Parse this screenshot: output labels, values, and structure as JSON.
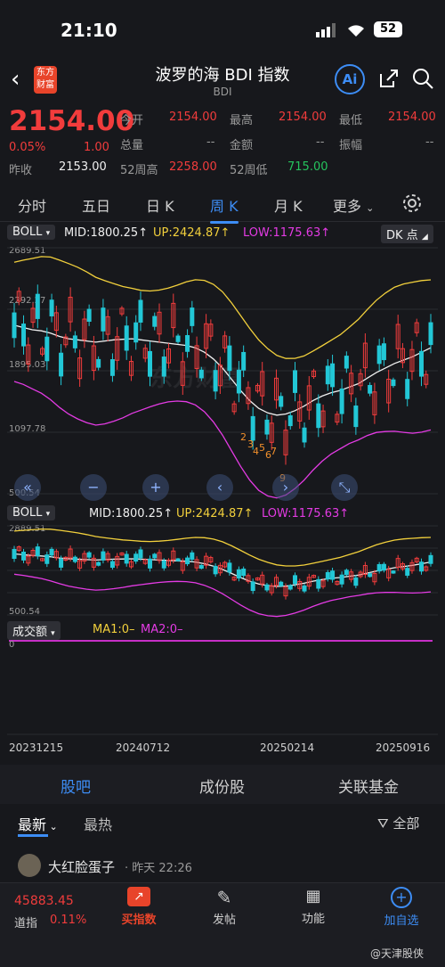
{
  "status": {
    "time": "21:10",
    "battery": "52"
  },
  "header": {
    "logo_line1": "东方",
    "logo_line2": "财富",
    "title": "波罗的海 BDI 指数",
    "subtitle": "BDI",
    "ai_label": "Ai"
  },
  "quote": {
    "price": "2154.00",
    "change_pct": "0.05%",
    "change_abs": "1.00",
    "prev_close_label": "昨收",
    "prev_close": "2153.00",
    "open_label": "今开",
    "open": "2154.00",
    "high_label": "最高",
    "high": "2154.00",
    "low_label": "最低",
    "low": "2154.00",
    "volume_label": "总量",
    "volume": "--",
    "amount_label": "金额",
    "amount": "--",
    "amplitude_label": "振幅",
    "amplitude": "--",
    "wk52_high_label": "52周高",
    "wk52_high": "2258.00",
    "wk52_low_label": "52周低",
    "wk52_low": "715.00"
  },
  "tabs": [
    "分时",
    "五日",
    "日 K",
    "周 K",
    "月 K",
    "更多"
  ],
  "indicator1": {
    "name": "BOLL",
    "mid": "MID:1800.25↑",
    "up": "UP:2424.87↑",
    "low": "LOW:1175.63↑",
    "dk": "DK 点"
  },
  "indicator2": {
    "name": "BOLL",
    "mid": "MID:1800.25↑",
    "up": "UP:2424.87↑",
    "low": "LOW:1175.63↑"
  },
  "indicator3": {
    "name": "成交额",
    "ma1": "MA1:0–",
    "ma2": "MA2:0–",
    "axis_zero": "0"
  },
  "main_axis": [
    "2689.51",
    "2292.27",
    "1895.03",
    "1097.78",
    "500.54"
  ],
  "sub_axis": [
    "2889.51",
    "500.54"
  ],
  "dates": [
    "20231215",
    "20240712",
    "20250214",
    "20250916"
  ],
  "watermark": "东方财富",
  "countdown_labels": [
    "2",
    "3",
    "4",
    "5",
    "6",
    "7",
    "9"
  ],
  "section_tabs": [
    "股吧",
    "成份股",
    "关联基金"
  ],
  "filters": {
    "latest": "最新",
    "hot": "最热",
    "all": "全部"
  },
  "post": {
    "user": "大红脸蛋子",
    "time": "昨天 22:26"
  },
  "bottom": {
    "index_value": "45883.45",
    "index_name": "道指",
    "index_change": "0.11%",
    "buy_label": "买指数",
    "post_label": "发帖",
    "func_label": "功能",
    "add_label": "加自选"
  },
  "credit": "@天津股侠",
  "chart_data": {
    "type": "candlestick",
    "series": [
      {
        "name": "MID",
        "value_last": 1800.25
      },
      {
        "name": "UP",
        "value_last": 2424.87
      },
      {
        "name": "LOW",
        "value_last": 1175.63
      }
    ],
    "y_ticks": [
      2689.51,
      2292.27,
      1895.03,
      1097.78,
      500.54
    ],
    "x_ticks": [
      "20231215",
      "20240712",
      "20250214",
      "20250916"
    ],
    "ylim": [
      500.54,
      2689.51
    ]
  },
  "colors": {
    "up": "#f13c3c",
    "down": "#22c7d6",
    "upper": "#f2d03c",
    "mid": "#f0f0f0",
    "lower": "#e43be4",
    "accent": "#3d8df5"
  }
}
